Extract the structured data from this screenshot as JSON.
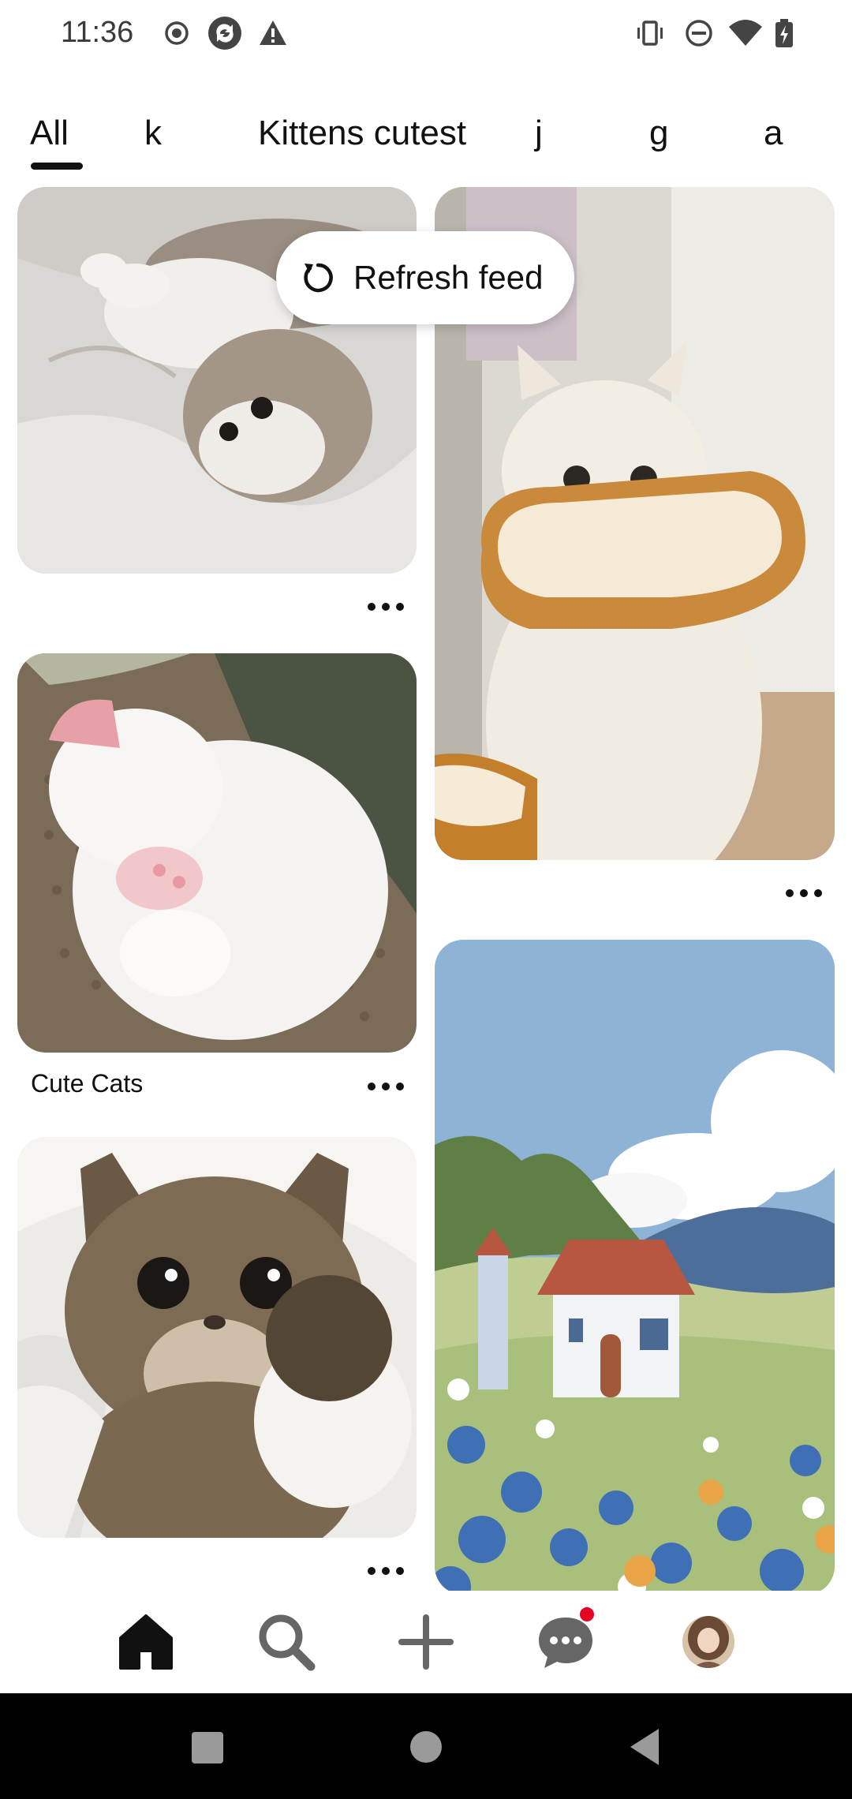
{
  "status_bar": {
    "time": "11:36",
    "left_icons": [
      "record-icon",
      "sync-app-icon",
      "warning-icon"
    ],
    "right_icons": [
      "vibrate-icon",
      "do-not-disturb-icon",
      "wifi-icon",
      "battery-charging-icon"
    ]
  },
  "tabs": [
    {
      "label": "All",
      "selected": true
    },
    {
      "label": "k",
      "selected": false
    },
    {
      "label": "Kittens cutest",
      "selected": false
    },
    {
      "label": "j",
      "selected": false
    },
    {
      "label": "g",
      "selected": false
    },
    {
      "label": "a",
      "selected": false
    }
  ],
  "refresh": {
    "label": "Refresh feed",
    "icon": "refresh-icon"
  },
  "pins": [
    {
      "subject": "grey and white kitten lying on white bedsheet",
      "title": ""
    },
    {
      "subject": "fluffy cream cat wearing bread-shaped collar",
      "title": ""
    },
    {
      "subject": "white kitten sleeping on brown cushion",
      "title": "Cute Cats"
    },
    {
      "subject": "tabby kitten under white blanket",
      "title": ""
    },
    {
      "subject": "illustrated cottage with blue flower field and mountains",
      "title": ""
    }
  ],
  "bottom_nav": [
    {
      "name": "home",
      "icon": "home-icon",
      "selected": true
    },
    {
      "name": "search",
      "icon": "search-icon"
    },
    {
      "name": "create",
      "icon": "plus-icon"
    },
    {
      "name": "messages",
      "icon": "chat-bubble-icon",
      "notification_dot": true
    },
    {
      "name": "profile",
      "icon": "avatar"
    }
  ],
  "colors": {
    "notification_dot": "#e60023",
    "text": "#111111"
  }
}
